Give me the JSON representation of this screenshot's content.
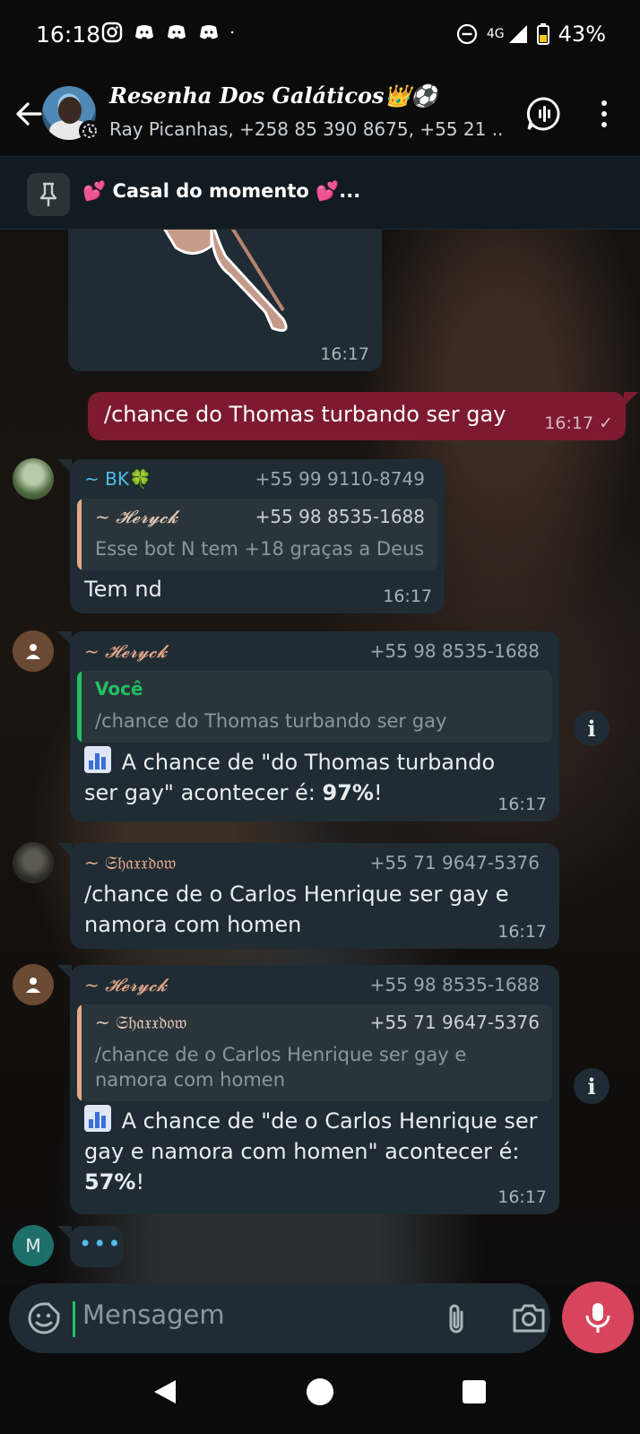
{
  "status": {
    "time": "16:18",
    "network": "4G",
    "battery": "43%"
  },
  "header": {
    "title": "Resenha Dos Galáticos👑⚽",
    "members": "Ray Picanhas, +258 85 390 8675, +55 21 ..."
  },
  "pinned": {
    "text": "💕 Casal do momento 💕..."
  },
  "messages": [
    {
      "type": "image",
      "time": "16:17"
    },
    {
      "type": "outgoing",
      "text": "/chance do Thomas turbando ser gay",
      "time": "16:17 ✓"
    },
    {
      "sender": "~ BK🍀",
      "phone": "+55 99 9110-8749",
      "quote": {
        "name": "~ 𝓗𝓮𝓻𝔂𝓬𝓴",
        "phone": "+55 98 8535-1688",
        "text": "Esse bot N tem +18 graças a Deus"
      },
      "text": "Tem nd",
      "time": "16:17"
    },
    {
      "sender": "~ 𝓗𝓮𝓻𝔂𝓬𝓴",
      "phone": "+55 98 8535-1688",
      "quote": {
        "name": "Você",
        "text": "/chance do Thomas turbando ser gay"
      },
      "text_line1": " A chance de \"do Thomas turbando",
      "text_line2_pre": "ser gay\" acontecer é: ",
      "text_bold": "97%",
      "text_end": "!",
      "time": "16:17"
    },
    {
      "sender": "~ 𝔖𝔥𝔞𝔵𝔵𝔡𝔬𝔴",
      "phone": "+55 71 9647-5376",
      "text_line1": "/chance de o Carlos Henrique ser gay e",
      "text_line2": "namora com homen",
      "time": "16:17"
    },
    {
      "sender": "~ 𝓗𝓮𝓻𝔂𝓬𝓴",
      "phone": "+55 98 8535-1688",
      "quote": {
        "name": "~ 𝔖𝔥𝔞𝔵𝔵𝔡𝔬𝔴",
        "phone": "+55 71 9647-5376",
        "text_line1": "/chance de o Carlos Henrique ser gay e",
        "text_line2": "namora com homen"
      },
      "text_line1": " A chance de \"de o Carlos Henrique ser",
      "text_line2": "gay e namora com homen\" acontecer é:",
      "text_bold": "57%",
      "text_end": "!",
      "time": "16:17"
    },
    {
      "type": "typing",
      "avatar_letter": "M",
      "text": "•••"
    }
  ],
  "input": {
    "placeholder": "Mensagem"
  },
  "colors": {
    "accent_green": "#21c063",
    "outgoing_bubble": "#7e1a2f",
    "incoming_bubble": "#1f2c33",
    "mic_button": "#d6455c"
  }
}
